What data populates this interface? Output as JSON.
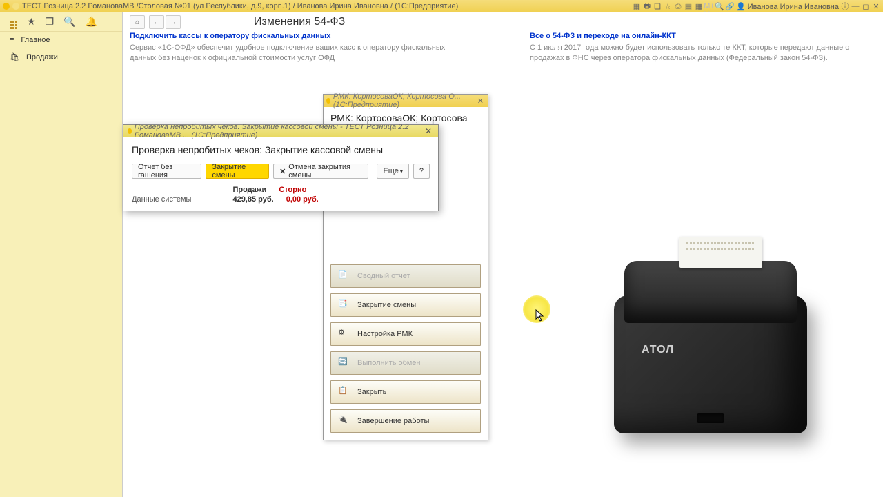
{
  "titlebar": {
    "text": "ТЕСТ Розница 2.2 РомановаМВ /Столовая №01 (ул Республики, д.9, корп.1) / Иванова Ирина Ивановна /  (1С:Предприятие)",
    "user": "Иванова Ирина Ивановна"
  },
  "sidebar": {
    "main": "Главное",
    "sales": "Продажи"
  },
  "page": {
    "title": "Изменения 54-ФЗ",
    "link1": "Подключить кассы к оператору фискальных данных",
    "desc1": "Сервис  «1С-ОФД» обеспечит удобное подключение ваших касс к оператору фискальных данных без наценок к официальной стоимости услуг ОФД",
    "link2": "Все о 54-ФЗ и переходе на онлайн-ККТ",
    "desc2": "С 1 июля 2017 года можно будет использовать только те ККТ, которые передают данные о продажах в ФНС через оператора фискальных данных (Федеральный закон 54-ФЗ)."
  },
  "rmk": {
    "wintitle": "РМК: КортосоваОК; Кортосова О...   (1С:Предприятие)",
    "header": "РМК: КортосоваОК; Кортосова О...",
    "btn_summary": "Сводный отчет",
    "btn_close_shift": "Закрытие смены",
    "btn_settings": "Настройка РМК",
    "btn_exchange": "Выполнить обмен",
    "btn_close": "Закрыть",
    "btn_shutdown": "Завершение работы"
  },
  "dialog": {
    "wintitle": "Проверка непробитых чеков: Закрытие кассовой смены - ТЕСТ Розница 2.2 РомановаМВ ...   (1С:Предприятие)",
    "header": "Проверка непробитых чеков: Закрытие кассовой смены",
    "btn_report": "Отчет без гашения",
    "btn_close_shift": "Закрытие смены",
    "btn_cancel": "Отмена закрытия смены",
    "btn_more": "Еще",
    "btn_help": "?",
    "sys_label": "Данные системы",
    "sales_label": "Продажи",
    "storno_label": "Сторно",
    "sales_value": "429,85 руб.",
    "storno_value": "0,00 руб."
  },
  "printer": {
    "brand": "АТОЛ"
  }
}
